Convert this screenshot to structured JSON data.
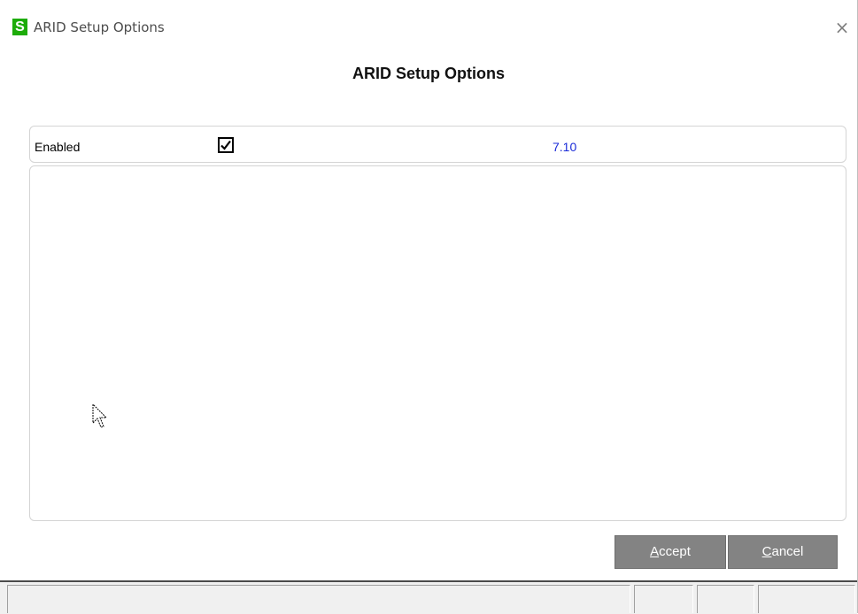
{
  "window": {
    "title": "ARID Setup Options",
    "app_icon": "S",
    "close_symbol": "×"
  },
  "heading": "ARID Setup Options",
  "options": {
    "enabled_label": "Enabled",
    "enabled_checked": true,
    "version": "7.10"
  },
  "buttons": {
    "accept_prefix": "A",
    "accept_rest": "ccept",
    "cancel_prefix": "C",
    "cancel_rest": "ancel"
  },
  "colors": {
    "logo_green": "#1dac0a",
    "version_blue": "#1a2bd8",
    "button_gray": "#838383"
  }
}
